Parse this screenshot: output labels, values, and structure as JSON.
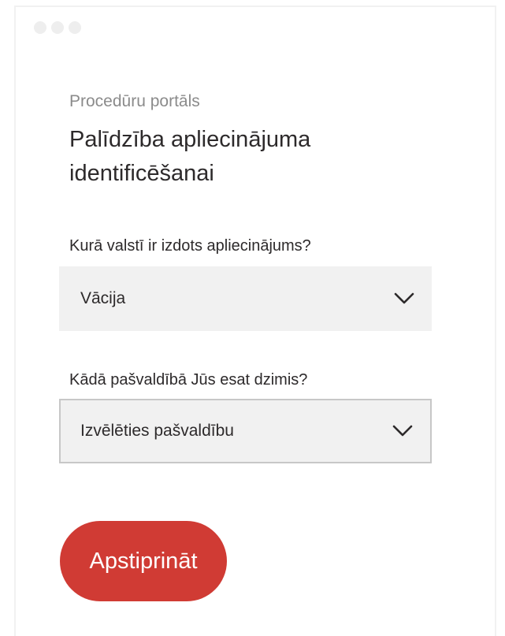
{
  "header": {
    "portal_label": "Procedūru portāls",
    "title": "Palīdzība apliecinājuma identificēšanai"
  },
  "form": {
    "country_question": "Kurā valstī ir izdots apliecinājums?",
    "country_value": "Vācija",
    "municipality_question": "Kādā pašvaldībā Jūs esat dzimis?",
    "municipality_value": "Izvēlēties pašvaldību",
    "confirm_label": "Apstiprināt"
  },
  "icons": {
    "window_controls": "window-dots",
    "dropdown": "chevron-down-icon"
  },
  "colors": {
    "accent": "#d03b34",
    "field_background": "#f1f1f1",
    "text": "#2d2a2b",
    "muted_text": "#8b8b8b"
  }
}
